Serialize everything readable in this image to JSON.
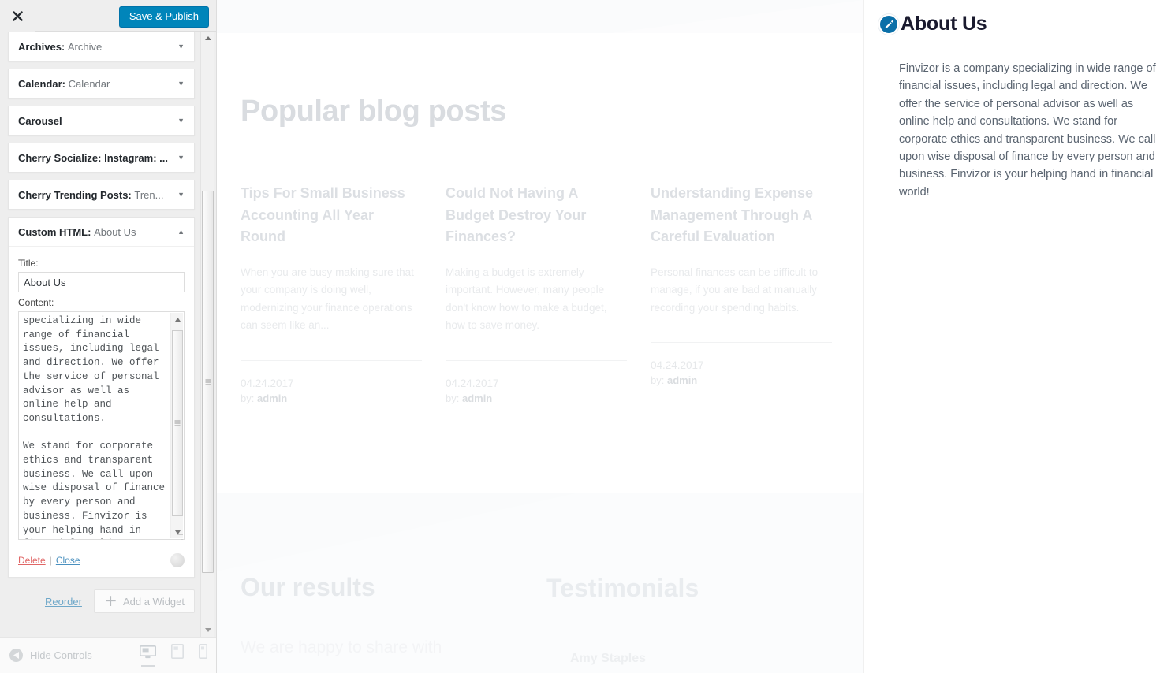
{
  "customizer": {
    "close_label": "Close customizer",
    "save_label": "Save & Publish",
    "widgets": [
      {
        "name": "Archives:",
        "instance": "Archive",
        "expanded": false
      },
      {
        "name": "Calendar:",
        "instance": "Calendar",
        "expanded": false
      },
      {
        "name": "Carousel",
        "instance": "",
        "expanded": false
      },
      {
        "name": "Cherry Socialize: Instagram: ...",
        "instance": "",
        "expanded": false
      },
      {
        "name": "Cherry Trending Posts:",
        "instance": "Tren...",
        "expanded": false
      },
      {
        "name": "Custom HTML:",
        "instance": "About Us",
        "expanded": true
      }
    ],
    "custom_html_widget": {
      "title_label": "Title:",
      "title_value": "About Us",
      "content_label": "Content:",
      "content_value": "specializing in wide range of financial issues, including legal and direction. We offer the service of personal advisor as well as online help and consultations.\n\nWe stand for corporate ethics and transparent business. We call upon wise disposal of finance by every person and business. Finvizor is your helping hand in financial world!",
      "delete_label": "Delete",
      "separator": "|",
      "close_label": "Close"
    },
    "actions": {
      "reorder_label": "Reorder",
      "add_widget_label": "Add a Widget"
    },
    "footer": {
      "hide_controls_label": "Hide Controls",
      "devices": [
        {
          "name": "desktop",
          "active": true
        },
        {
          "name": "tablet",
          "active": false
        },
        {
          "name": "mobile",
          "active": false
        }
      ]
    }
  },
  "preview": {
    "blog_section_title": "Popular blog posts",
    "posts": [
      {
        "title": "Tips For Small Business Accounting All Year Round",
        "excerpt": "When you are busy making sure that your company is doing well, modernizing your finance operations can seem like an...",
        "date": "04.24.2017",
        "by_label": "by:",
        "author": "admin"
      },
      {
        "title": "Could Not Having A Budget Destroy Your Finances?",
        "excerpt": "Making a budget is extremely important. However, many people don't know how to make a budget, how to save money.",
        "date": "04.24.2017",
        "by_label": "by:",
        "author": "admin"
      },
      {
        "title": "Understanding Expense Management Through A Careful Evaluation",
        "excerpt": "Personal finances can be difficult to manage, if you are bad at manually recording your spending habits.",
        "date": "04.24.2017",
        "by_label": "by:",
        "author": "admin"
      }
    ],
    "results_title": "Our results",
    "results_text": "We are happy to share with",
    "testimonials_title": "Testimonials",
    "testimonial_name": "Amy Staples"
  },
  "right_panel": {
    "title": "About Us",
    "body": "Finvizor is a company specializing in wide range of financial issues, including legal and direction. We offer the service of personal advisor as well as online help and consultations. We stand for corporate ethics and transparent business. We call upon wise disposal of finance by every person and business. Finvizor is your helping hand in financial world!"
  },
  "colors": {
    "accent_blue": "#0085ba",
    "edit_badge_blue": "#0a6fa8",
    "delete_red": "#e06666",
    "link_blue": "#4a90bf",
    "sidebar_bg": "#eeeeee"
  }
}
